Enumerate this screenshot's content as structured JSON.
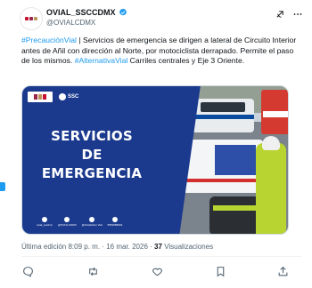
{
  "account": {
    "display_name": "OVIAL_SSCCDMX",
    "handle": "@OVIALCDMX"
  },
  "tweet": {
    "hashtag_1": "#PrecauciónVial",
    "text_1": " | Servicios de emergencia se dirigen a lateral de Circuito Interior antes de Añil con dirección al Norte, por motociclista derrapado. Permite el paso de los mismos. ",
    "hashtag_2": "#AlternativaVial",
    "text_2": " Carriles centrales y Eje 3 Oriente."
  },
  "media": {
    "title_line_1": "SERVICIOS",
    "title_line_2": "DE",
    "title_line_3": "EMERGENCIA",
    "brand_label": "SSC",
    "social_labels": [
      "ovial_sscdmx",
      "@OVIALCDMX",
      "@Ovialcdmx Vial",
      "5552086002"
    ]
  },
  "meta": {
    "edited_label": "Última edición",
    "time": "8:09 p. m.",
    "separator": "·",
    "date": "16 mar. 2026",
    "views_count": "37",
    "views_label": "Visualizaciones"
  },
  "icons": {
    "grok": "grok-icon",
    "verified": "verified-badge-icon",
    "more": "more-icon",
    "reply": "reply-icon",
    "retweet": "retweet-icon",
    "like": "heart-icon",
    "bookmark": "bookmark-icon",
    "share": "share-icon"
  },
  "colors": {
    "accent": "#1d9bf0",
    "media_blue": "#1b3a8e",
    "text_primary": "#0f1419",
    "text_secondary": "#536471"
  }
}
